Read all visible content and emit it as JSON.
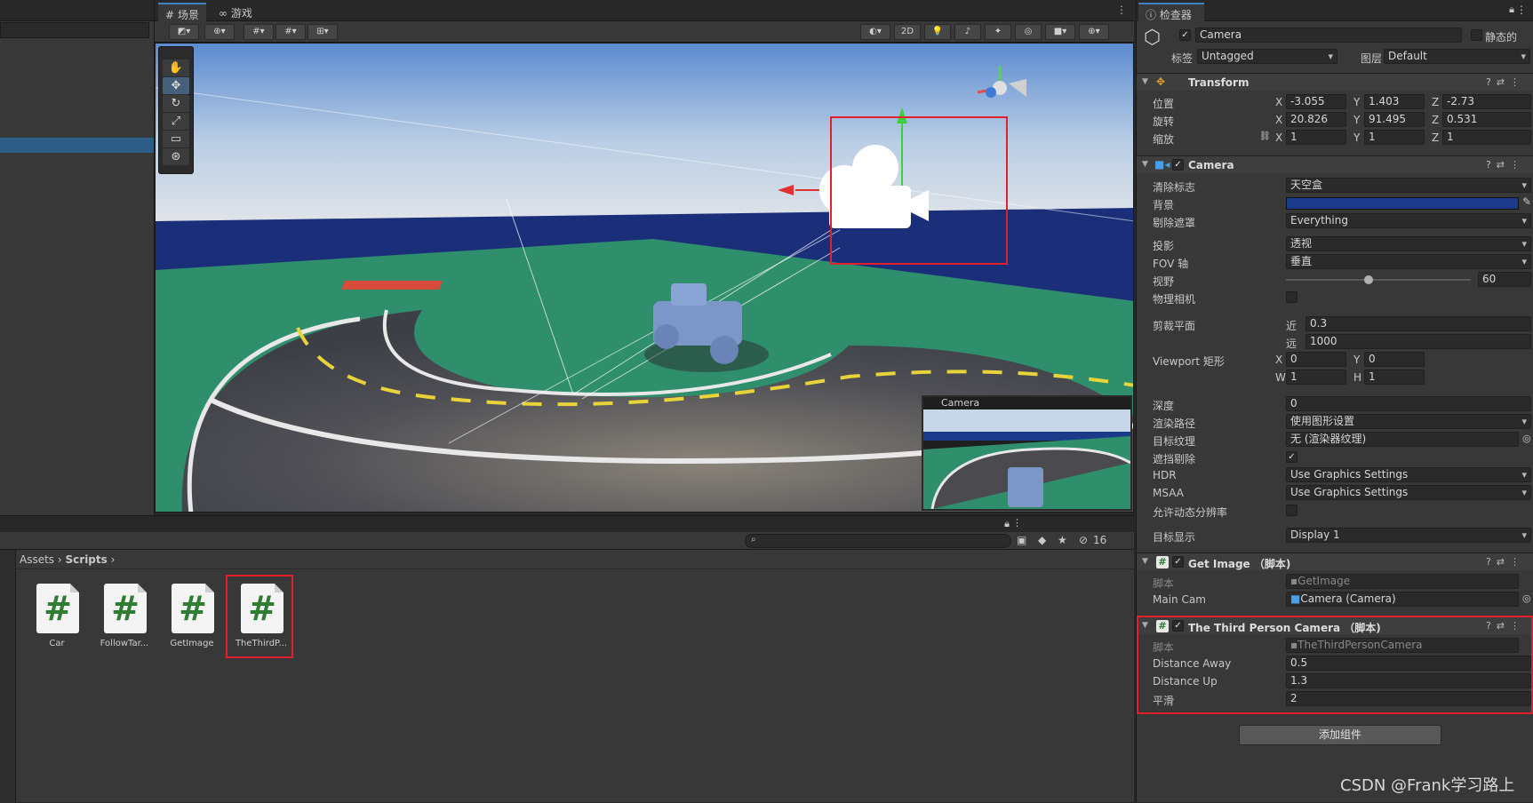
{
  "scene_tabs": {
    "scene": "场景",
    "game": "游戏"
  },
  "scene_toolbar": {
    "mode_2d": "2D"
  },
  "tools": [
    "hand",
    "move",
    "rotate",
    "scale",
    "rect",
    "transform"
  ],
  "camera_preview": {
    "title": "Camera"
  },
  "project": {
    "breadcrumb_root": "Assets",
    "breadcrumb_folder": "Scripts",
    "hidden_count": "16",
    "assets": [
      {
        "label": "Car"
      },
      {
        "label": "FollowTar..."
      },
      {
        "label": "GetImage"
      },
      {
        "label": "TheThirdP..."
      }
    ]
  },
  "inspector": {
    "tab": "检查器",
    "object_name": "Camera",
    "static_label": "静态的",
    "tag_label": "标签",
    "tag_value": "Untagged",
    "layer_label": "图层",
    "layer_value": "Default",
    "transform": {
      "title": "Transform",
      "position_label": "位置",
      "rotation_label": "旋转",
      "scale_label": "缩放",
      "position": {
        "x": "-3.055",
        "y": "1.403",
        "z": "-2.73"
      },
      "rotation": {
        "x": "20.826",
        "y": "91.495",
        "z": "0.531"
      },
      "scale": {
        "x": "1",
        "y": "1",
        "z": "1"
      }
    },
    "camera": {
      "title": "Camera",
      "clear_flags_label": "清除标志",
      "clear_flags": "天空盒",
      "background_label": "背景",
      "background_color": "#1c3a8a",
      "culling_label": "剔除遮罩",
      "culling": "Everything",
      "projection_label": "投影",
      "projection": "透视",
      "fov_axis_label": "FOV 轴",
      "fov_axis": "垂直",
      "fov_label": "视野",
      "fov": "60",
      "physical_label": "物理相机",
      "clip_label": "剪裁平面",
      "near_label": "近",
      "near": "0.3",
      "far_label": "远",
      "far": "1000",
      "viewport_label": "Viewport 矩形",
      "vp_x": "0",
      "vp_y": "0",
      "vp_w": "1",
      "vp_h": "1",
      "depth_label": "深度",
      "depth": "0",
      "render_path_label": "渲染路径",
      "render_path": "使用图形设置",
      "target_texture_label": "目标纹理",
      "target_texture": "无 (渲染器纹理)",
      "occlusion_label": "遮挡剔除",
      "hdr_label": "HDR",
      "hdr": "Use Graphics Settings",
      "msaa_label": "MSAA",
      "msaa": "Use Graphics Settings",
      "dynamic_res_label": "允许动态分辨率",
      "target_display_label": "目标显示",
      "target_display": "Display 1"
    },
    "get_image": {
      "title": "Get Image （脚本)",
      "script_label": "脚本",
      "script": "GetImage",
      "main_cam_label": "Main Cam",
      "main_cam": "Camera (Camera)"
    },
    "third_person": {
      "title": "The Third Person Camera （脚本)",
      "script_label": "脚本",
      "script": "TheThirdPersonCamera",
      "distance_away_label": "Distance Away",
      "distance_away": "0.5",
      "distance_up_label": "Distance Up",
      "distance_up": "1.3",
      "smooth_label": "平滑",
      "smooth": "2"
    },
    "add_component": "添加组件"
  },
  "watermark": "CSDN @Frank学习路上"
}
